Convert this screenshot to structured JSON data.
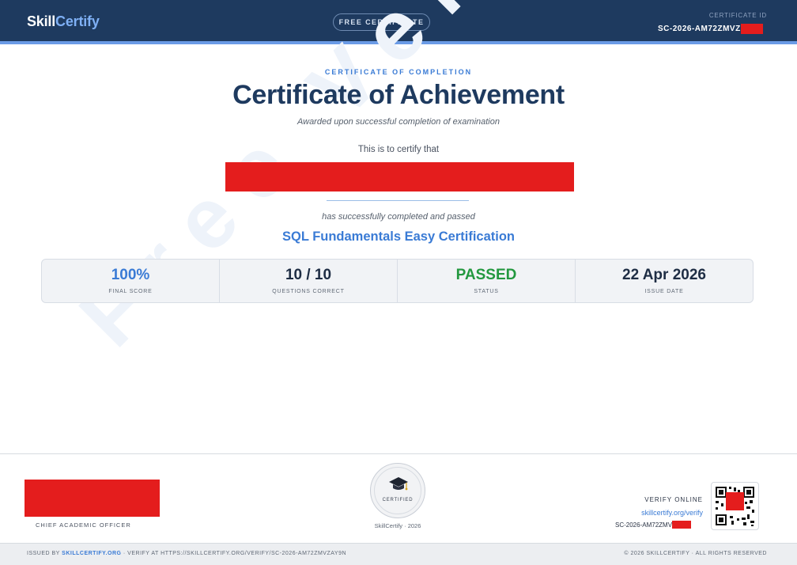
{
  "header": {
    "logo_part1": "Skill",
    "logo_part2": "Certify",
    "badge": "FREE CERTIFICATE",
    "cert_id_label": "CERTIFICATE ID",
    "cert_id_value": "SC-2026-AM72ZMVZ"
  },
  "watermark": "Free Version",
  "certificate": {
    "kicker": "CERTIFICATE OF COMPLETION",
    "title": "Certificate of Achievement",
    "subtitle": "Awarded upon successful completion of examination",
    "certify_text": "This is to certify that",
    "completed_text": "has successfully completed and passed",
    "course": "SQL Fundamentals Easy Certification"
  },
  "stats": [
    {
      "value": "100%",
      "label": "FINAL SCORE"
    },
    {
      "value": "10 / 10",
      "label": "QUESTIONS CORRECT"
    },
    {
      "value": "PASSED",
      "label": "STATUS"
    },
    {
      "value": "22 Apr 2026",
      "label": "ISSUE DATE"
    }
  ],
  "signature": {
    "label": "CHIEF ACADEMIC OFFICER"
  },
  "seal": {
    "text": "CERTIFIED",
    "caption": "SkillCertify · 2026"
  },
  "verify": {
    "label": "VERIFY ONLINE",
    "link": "skillcertify.org/verify",
    "id": "SC-2026-AM72ZMV"
  },
  "footer": {
    "left_prefix": "ISSUED BY ",
    "left_brand": "SKILLCERTIFY.ORG",
    "left_suffix": " · VERIFY AT HTTPS://SKILLCERTIFY.ORG/VERIFY/SC-2026-AM72ZMVZAY9N",
    "right": "© 2026 SKILLCERTIFY · ALL RIGHTS RESERVED"
  },
  "colors": {
    "header_bg": "#1e3a5f",
    "accent": "#3a7bd5",
    "passed": "#23983f",
    "redaction": "#e41d1d"
  }
}
